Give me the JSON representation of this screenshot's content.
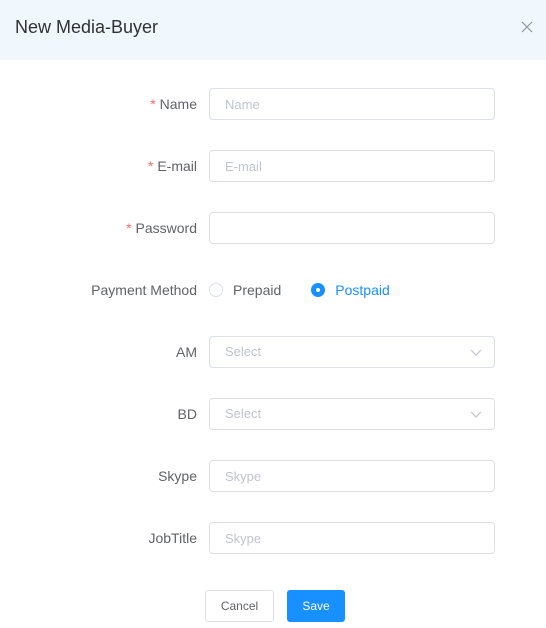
{
  "dialog": {
    "title": "New Media-Buyer",
    "close_icon": "close-icon"
  },
  "form": {
    "name": {
      "label": "Name",
      "required": "*",
      "placeholder": "Name",
      "value": ""
    },
    "email": {
      "label": "E-mail",
      "required": "*",
      "placeholder": "E-mail",
      "value": ""
    },
    "password": {
      "label": "Password",
      "required": "*",
      "placeholder": "",
      "value": ""
    },
    "payment_method": {
      "label": "Payment Method",
      "options": [
        "Prepaid",
        "Postpaid"
      ],
      "selected": "Postpaid"
    },
    "am": {
      "label": "AM",
      "placeholder": "Select",
      "icon": "chevron-down-icon"
    },
    "bd": {
      "label": "BD",
      "placeholder": "Select",
      "icon": "chevron-down-icon"
    },
    "skype": {
      "label": "Skype",
      "placeholder": "Skype",
      "value": ""
    },
    "jobtitle": {
      "label": "JobTitle",
      "placeholder": "Skype",
      "value": ""
    }
  },
  "actions": {
    "cancel_label": "Cancel",
    "save_label": "Save"
  },
  "colors": {
    "primary": "#1890ff",
    "required": "#f56c6c",
    "header_bg": "#f0f8fe"
  }
}
